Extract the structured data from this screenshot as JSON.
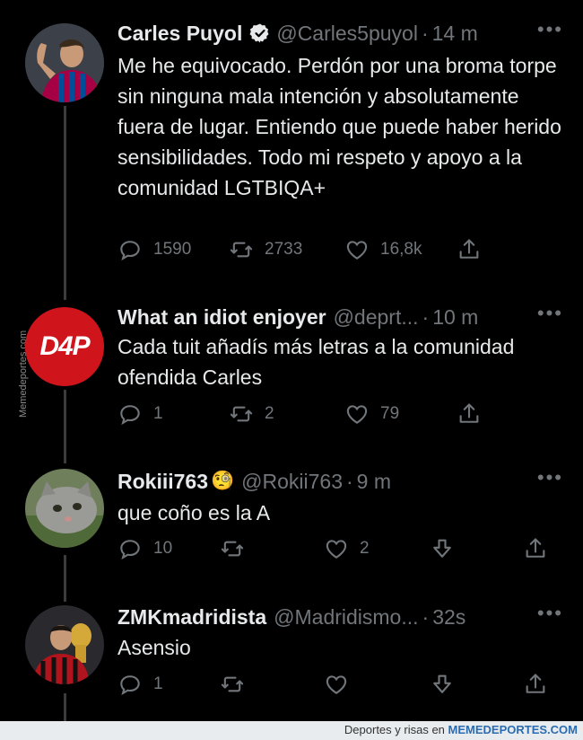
{
  "tweets": [
    {
      "name": "Carles Puyol",
      "handle": "@Carles5puyol",
      "time": "14 m",
      "text": "Me he equivocado. Perdón por una broma torpe sin ninguna mala intención y absolutamente fuera de lugar. Entiendo que puede haber herido sensibilidades. Todo mi respeto y apoyo a la comunidad LGTBIQA+",
      "replies": "1590",
      "retweets": "2733",
      "likes": "16,8k",
      "verified": true
    },
    {
      "name": "What an idiot enjoyer",
      "handle": "@deprt...",
      "time": "10 m",
      "text": "Cada tuit añadís más letras a la comunidad ofendida Carles",
      "replies": "1",
      "retweets": "2",
      "likes": "79",
      "avatar_label": "D4P"
    },
    {
      "name": "Rokiii763",
      "emoji": "🧐",
      "handle": "@Rokii763",
      "time": "9 m",
      "text": "que coño es la A",
      "replies": "10",
      "likes": "2"
    },
    {
      "name": "ZMKmadridista",
      "handle": "@Madridismo...",
      "time": "32s",
      "text": "Asensio",
      "replies": "1"
    }
  ],
  "more_label": "•••",
  "watermark": "Memedeportes.com",
  "footer": {
    "prefix": "Deportes y risas en",
    "brand": "MEMEDEPORTES.COM"
  },
  "colors": {
    "background": "#000000",
    "text": "#e7e9ea",
    "secondary": "#71767b",
    "thread_line": "#3a3d40",
    "d4p_red": "#d0141c"
  },
  "icons": [
    "reply-icon",
    "retweet-icon",
    "like-icon",
    "share-icon",
    "downvote-icon",
    "verified-icon",
    "more-icon"
  ]
}
